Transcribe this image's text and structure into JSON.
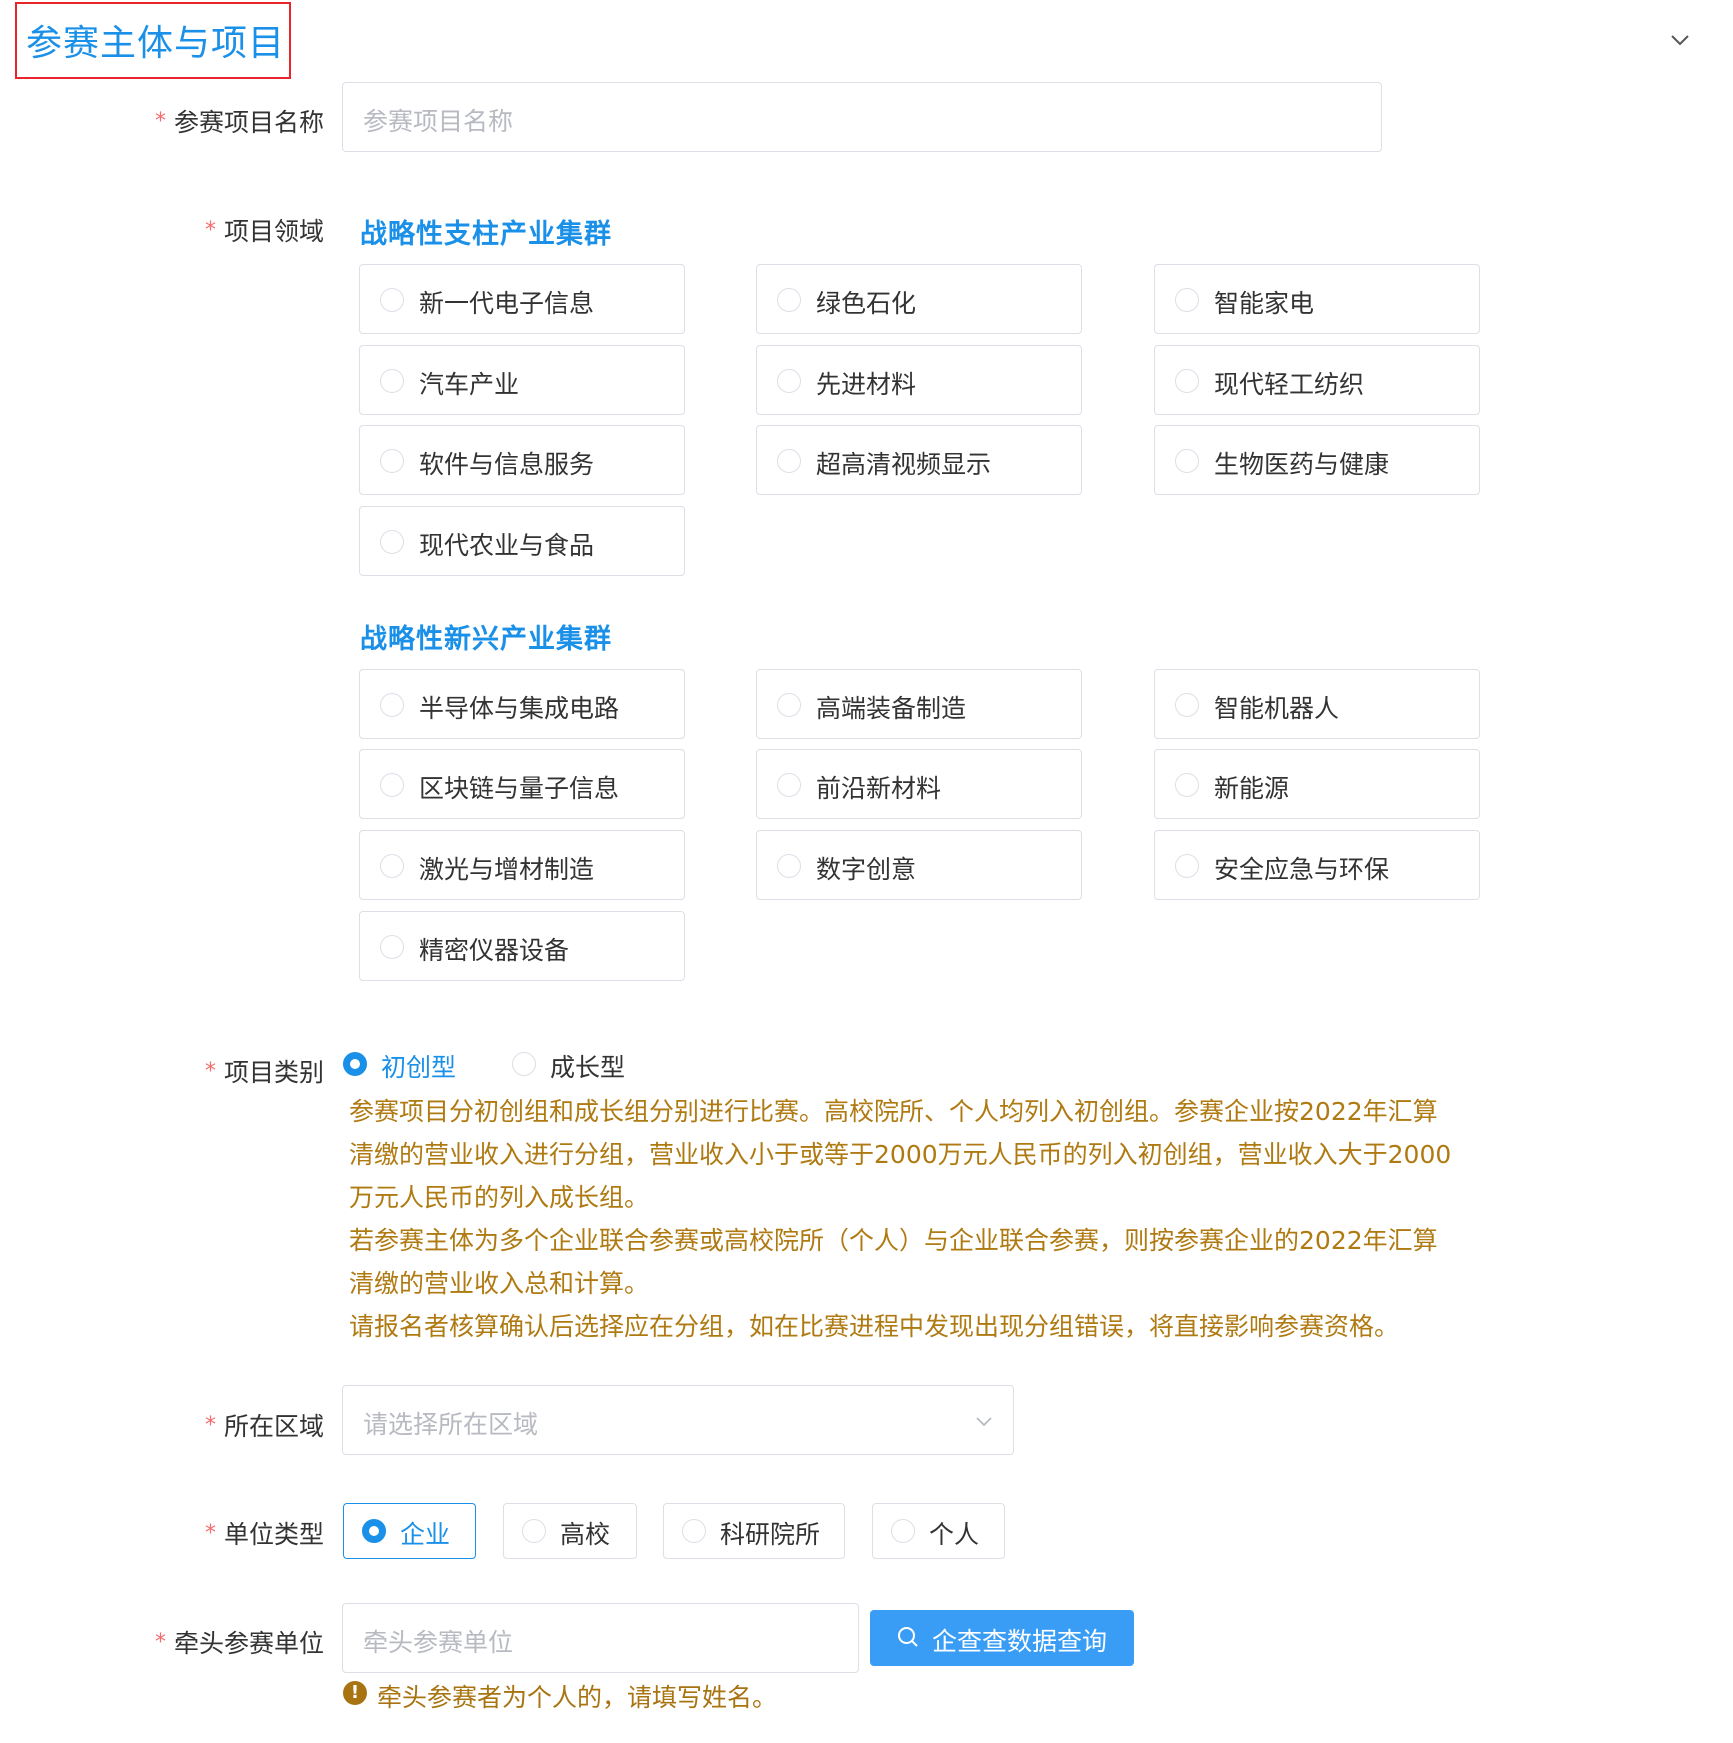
{
  "section": {
    "title": "参赛主体与项目"
  },
  "icons": {
    "collapse": "chevron-down-icon",
    "select_arrow": "chevron-down-icon",
    "search": "search-icon",
    "warning": "exclamation-icon"
  },
  "colors": {
    "accent": "#1a90e8",
    "required": "#f56c6c",
    "note": "#b07a12",
    "highlight_border": "#e8252a"
  },
  "required_mark": "*",
  "project_name": {
    "label": "参赛项目名称",
    "placeholder": "参赛项目名称",
    "value": ""
  },
  "project_domain": {
    "label": "项目领域",
    "groups": [
      {
        "title": "战略性支柱产业集群",
        "options": [
          "新一代电子信息",
          "绿色石化",
          "智能家电",
          "汽车产业",
          "先进材料",
          "现代轻工纺织",
          "软件与信息服务",
          "超高清视频显示",
          "生物医药与健康",
          "现代农业与食品"
        ]
      },
      {
        "title": "战略性新兴产业集群",
        "options": [
          "半导体与集成电路",
          "高端装备制造",
          "智能机器人",
          "区块链与量子信息",
          "前沿新材料",
          "新能源",
          "激光与增材制造",
          "数字创意",
          "安全应急与环保",
          "精密仪器设备"
        ]
      }
    ],
    "selected": null
  },
  "project_type": {
    "label": "项目类别",
    "options": [
      "初创型",
      "成长型"
    ],
    "selected": "初创型",
    "note_lines": [
      "参赛项目分初创组和成长组分别进行比赛。高校院所、个人均列入初创组。参赛企业按2022年汇算",
      "清缴的营业收入进行分组，营业收入小于或等于2000万元人民币的列入初创组，营业收入大于2000",
      "万元人民币的列入成长组。",
      "若参赛主体为多个企业联合参赛或高校院所（个人）与企业联合参赛，则按参赛企业的2022年汇算",
      "清缴的营业收入总和计算。",
      "请报名者核算确认后选择应在分组，如在比赛进程中发现出现分组错误，将直接影响参赛资格。"
    ]
  },
  "region": {
    "label": "所在区域",
    "placeholder": "请选择所在区域",
    "value": ""
  },
  "unit_type": {
    "label": "单位类型",
    "options": [
      "企业",
      "高校",
      "科研院所",
      "个人"
    ],
    "selected": "企业"
  },
  "lead_unit": {
    "label": "牵头参赛单位",
    "placeholder": "牵头参赛单位",
    "value": "",
    "query_button": "企查查数据查询",
    "warning": "牵头参赛者为个人的，请填写姓名。"
  }
}
